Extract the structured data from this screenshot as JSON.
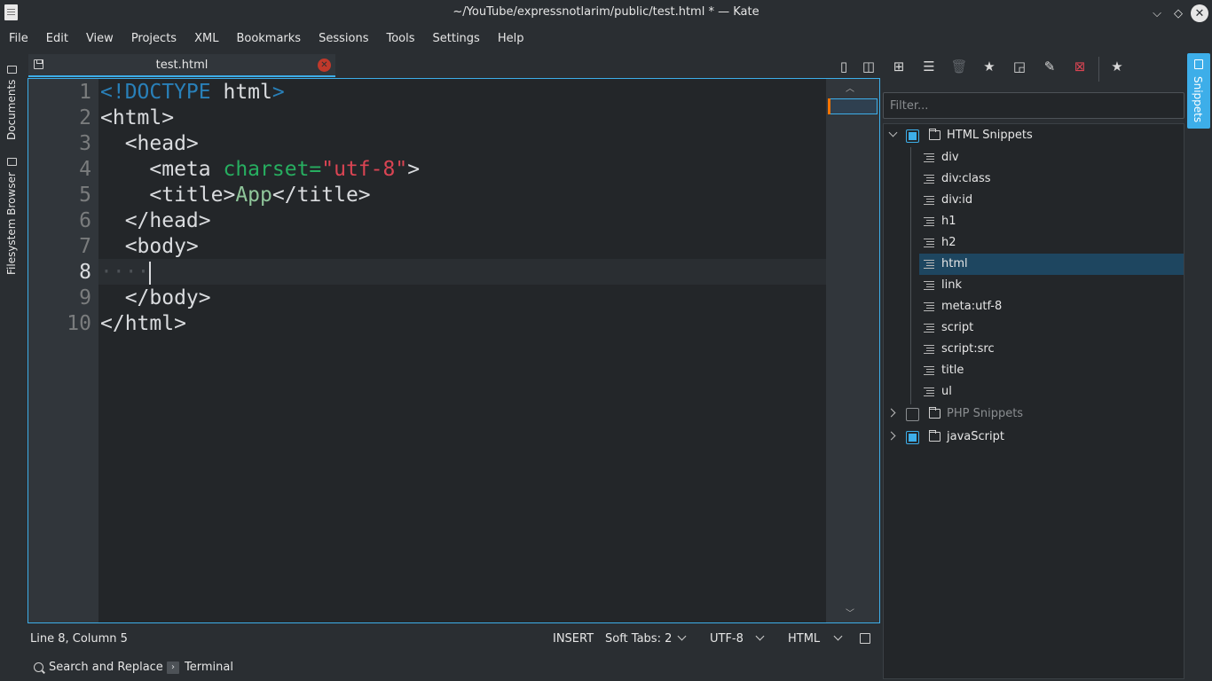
{
  "window": {
    "title": "~/YouTube/expressnotlarim/public/test.html * — Kate",
    "close_glyph": "✕",
    "min_glyph": "⌵",
    "max_glyph": "◇"
  },
  "menu": [
    "File",
    "Edit",
    "View",
    "Projects",
    "XML",
    "Bookmarks",
    "Sessions",
    "Tools",
    "Settings",
    "Help"
  ],
  "left_sidebar": {
    "documents": "Documents",
    "filesystem_browser": "Filesystem Browser"
  },
  "tab": {
    "label": "test.html",
    "close_glyph": "✕"
  },
  "editor": {
    "line_numbers": [
      "1",
      "2",
      "3",
      "4",
      "5",
      "6",
      "7",
      "8",
      "9",
      "10"
    ],
    "current_line": 8,
    "lines": {
      "l1_kw": "<!DOCTYPE",
      "l1_rest": " html",
      "l1_end": ">",
      "l2": "<html>",
      "l3": "  <head>",
      "l4_tag": "    <meta ",
      "l4_attr": "charset=",
      "l4_val": "\"utf-8\"",
      "l4_end": ">",
      "l5_open": "    <title>",
      "l5_text": "App",
      "l5_close": "</title>",
      "l6": "  </head>",
      "l7": "  <body>",
      "l8_ws": "····",
      "l9": "  </body>",
      "l10": "</html>"
    }
  },
  "status": {
    "position": "Line 8, Column 5",
    "mode": "INSERT",
    "indent": "Soft Tabs: 2",
    "encoding": "UTF-8",
    "syntax": "HTML"
  },
  "bottom": {
    "search_replace": "Search and Replace",
    "terminal": "Terminal",
    "terminal_glyph": "›"
  },
  "toolbar_icons": [
    "new-snippet-icon",
    "split-icon",
    "new-repository-icon",
    "edit-snippet-icon",
    "delete-icon",
    "get-hot-new-stuff-icon",
    "new-note-icon",
    "pencil-icon",
    "close-red-icon",
    "star-icon"
  ],
  "snippets": {
    "tab_label": "Snippets",
    "filter_placeholder": "Filter...",
    "groups": [
      {
        "name": "HTML Snippets",
        "checked": true,
        "expanded": true,
        "items": [
          "div",
          "div:class",
          "div:id",
          "h1",
          "h2",
          "html",
          "link",
          "meta:utf-8",
          "script",
          "script:src",
          "title",
          "ul"
        ],
        "selected": "html"
      },
      {
        "name": "PHP Snippets",
        "checked": false,
        "expanded": false
      },
      {
        "name": "javaScript",
        "checked": true,
        "expanded": false
      }
    ]
  },
  "colors": {
    "accent": "#3daee9",
    "background": "#2a2e32",
    "editor_bg": "#232629",
    "keyword_blue": "#2980b9",
    "attr_green": "#27ae60",
    "string_red": "#da4453"
  }
}
